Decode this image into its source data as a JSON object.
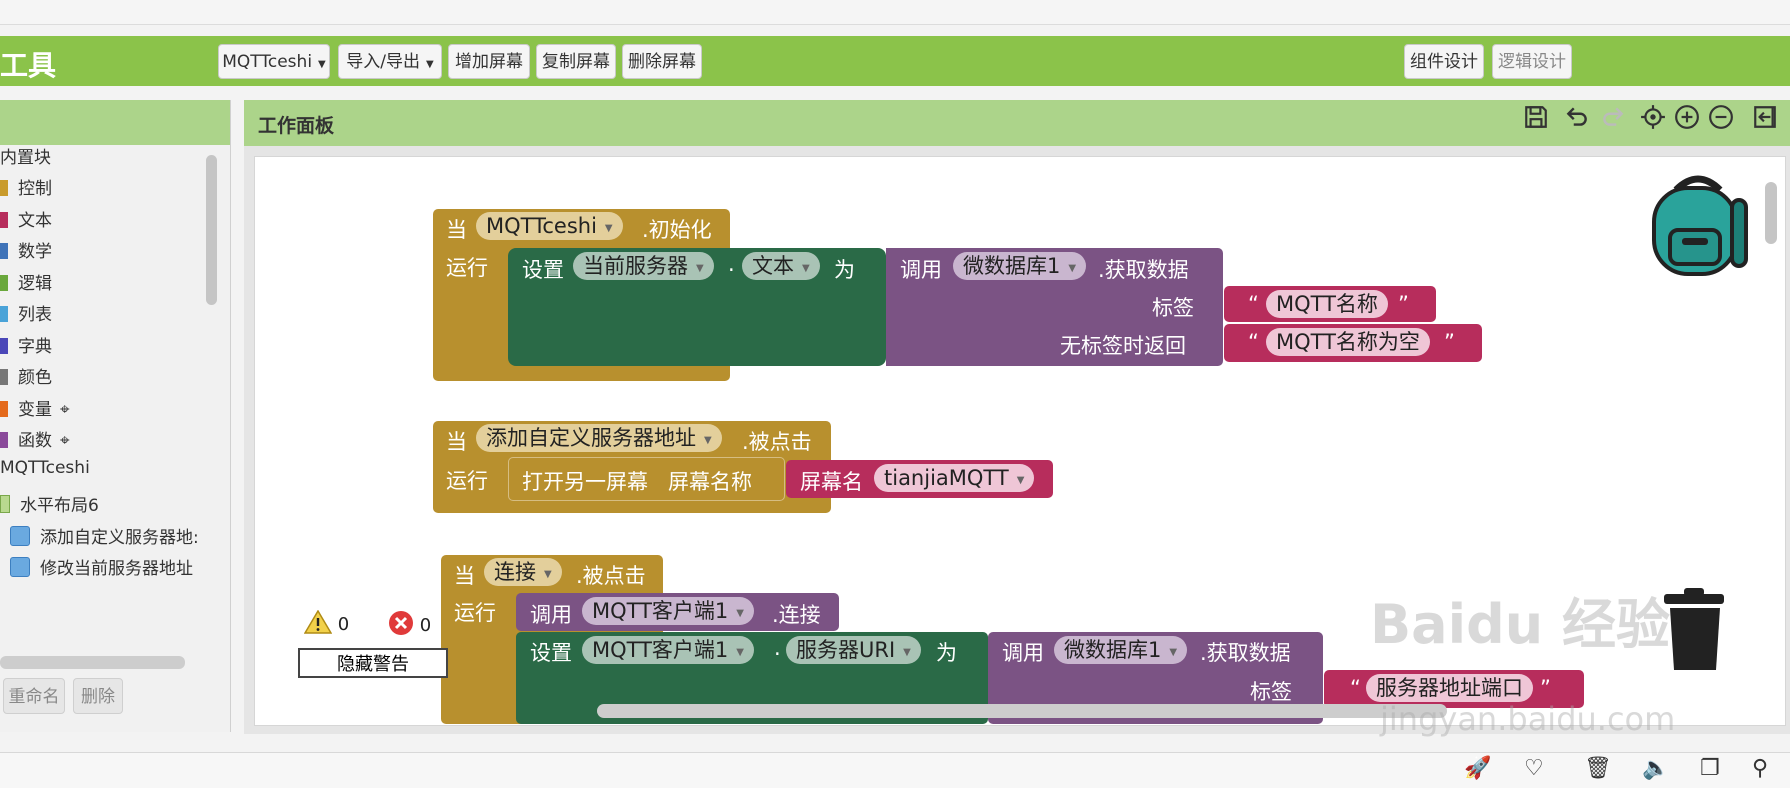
{
  "app": {
    "title": "工具"
  },
  "toolbar": {
    "project_label": "MQTTceshi",
    "import_export_label": "导入/导出",
    "add_screen_label": "增加屏幕",
    "copy_screen_label": "复制屏幕",
    "delete_screen_label": "删除屏幕",
    "designer_label": "组件设计",
    "blocks_label": "逻辑设计"
  },
  "palette": {
    "builtin_label": "内置块",
    "items": [
      {
        "label": "控制",
        "color": "#c99b2c"
      },
      {
        "label": "文本",
        "color": "#b72d5c"
      },
      {
        "label": "数学",
        "color": "#3f73b8"
      },
      {
        "label": "逻辑",
        "color": "#6aa83c"
      },
      {
        "label": "列表",
        "color": "#4aa3d8"
      },
      {
        "label": "字典",
        "color": "#4b47b8"
      },
      {
        "label": "颜色",
        "color": "#777777"
      },
      {
        "label": "变量",
        "color": "#e46a1c"
      },
      {
        "label": "函数",
        "color": "#8a4a9a"
      }
    ],
    "screen_label": "MQTTceshi",
    "tree_parent": "水平布局6",
    "tree_children": [
      "添加自定义服务器地:",
      "修改当前服务器地址"
    ],
    "rename_label": "重命名",
    "delete_label": "删除"
  },
  "workspace": {
    "title": "工作面板"
  },
  "blocks": {
    "when": "当",
    "do": "运行",
    "set": "设置",
    "to": "为",
    "call": "调用",
    "b1": {
      "component": "MQTTceshi",
      "event": ".初始化",
      "target": "当前服务器",
      "prop": "文本",
      "db": "微数据库1",
      "method": ".获取数据",
      "tag_label": "标签",
      "tag_value": "MQTT名称",
      "default_label": "无标签时返回",
      "default_value": "MQTT名称为空"
    },
    "b2": {
      "component": "添加自定义服务器地址",
      "event": ".被点击",
      "open_label": "打开另一屏幕",
      "screen_name_label": "屏幕名称",
      "screen_label": "屏幕名",
      "screen_value": "tianjiaMQTT"
    },
    "b3": {
      "component": "连接",
      "event": ".被点击",
      "client": "MQTT客户端1",
      "connect": ".连接",
      "prop": "服务器URI",
      "db": "微数据库1",
      "method": ".获取数据",
      "tag_label": "标签",
      "tag_value": "服务器地址端口"
    }
  },
  "warnings": {
    "warning_count": "0",
    "error_count": "0",
    "hide_label": "隐藏警告"
  },
  "watermark": {
    "brand": "Baidu 经验",
    "url": "jingyan.baidu.com"
  }
}
